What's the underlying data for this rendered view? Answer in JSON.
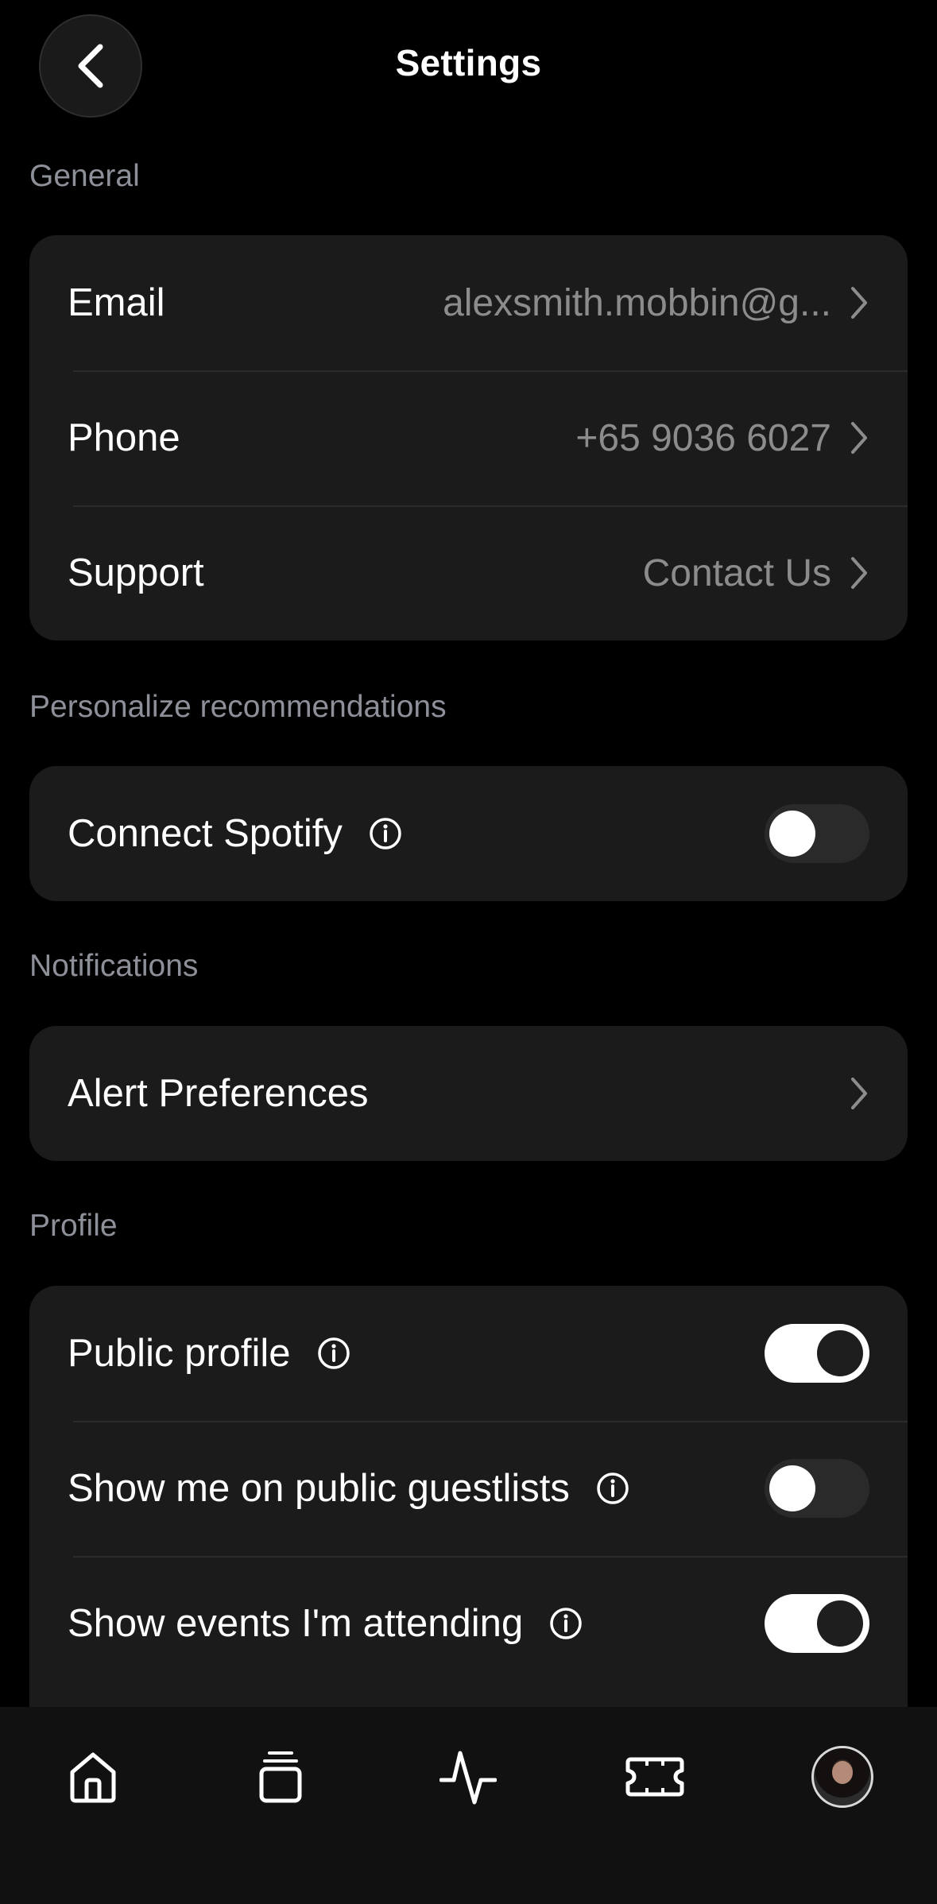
{
  "header": {
    "title": "Settings"
  },
  "sections": [
    {
      "label": "General",
      "rows": [
        {
          "label": "Email",
          "value": "alexsmith.mobbin@g..."
        },
        {
          "label": "Phone",
          "value": "+65 9036 6027"
        },
        {
          "label": "Support",
          "value": "Contact Us"
        }
      ]
    },
    {
      "label": "Personalize recommendations",
      "rows": [
        {
          "label": "Connect Spotify",
          "toggle": false
        }
      ]
    },
    {
      "label": "Notifications",
      "rows": [
        {
          "label": "Alert Preferences"
        }
      ]
    },
    {
      "label": "Profile",
      "rows": [
        {
          "label": "Public profile",
          "toggle": true
        },
        {
          "label": "Show me on public guestlists",
          "toggle": false
        },
        {
          "label": "Show events I'm attending",
          "toggle": true
        }
      ]
    }
  ],
  "tabbar": {
    "items": [
      {
        "icon": "home-icon"
      },
      {
        "icon": "stack-icon"
      },
      {
        "icon": "activity-icon"
      },
      {
        "icon": "ticket-icon"
      },
      {
        "icon": "profile-avatar"
      }
    ]
  }
}
